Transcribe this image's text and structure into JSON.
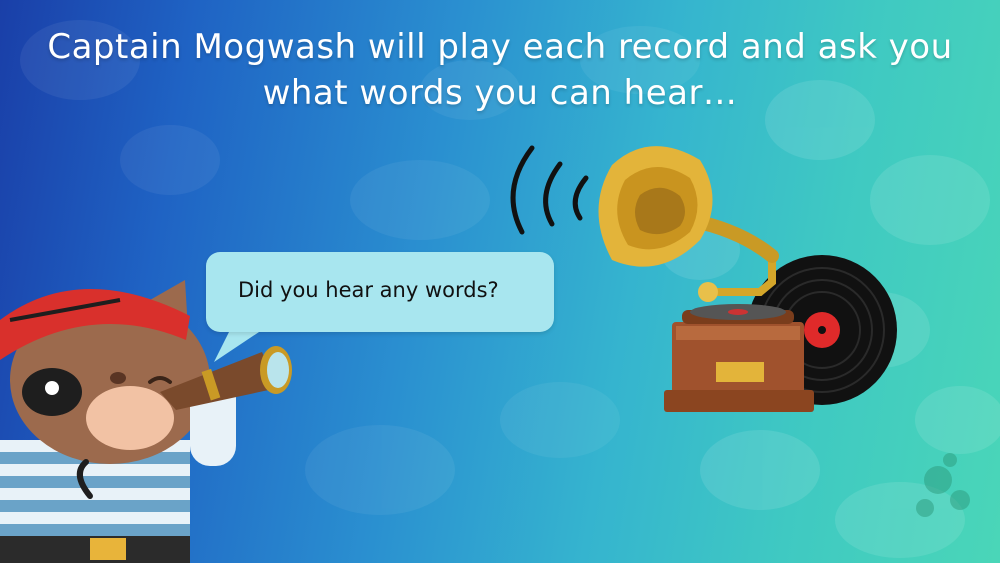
{
  "slide": {
    "title_line1": "Captain Mogwash will play each record and ask you",
    "title_line2": "what words you can hear…",
    "speech_bubble": "Did you hear any words?"
  },
  "illustrations": {
    "character": "pirate-cat-icon",
    "gramophone": "gramophone-icon",
    "record": "vinyl-record-icon",
    "sound_waves": "sound-waves-icon",
    "telescope": "telescope-icon"
  },
  "colors": {
    "background_left": "#1a3fa8",
    "background_right": "#4ad6b8",
    "bubble": "#a8e6ef",
    "text_title": "#ffffff",
    "text_bubble": "#111111"
  }
}
